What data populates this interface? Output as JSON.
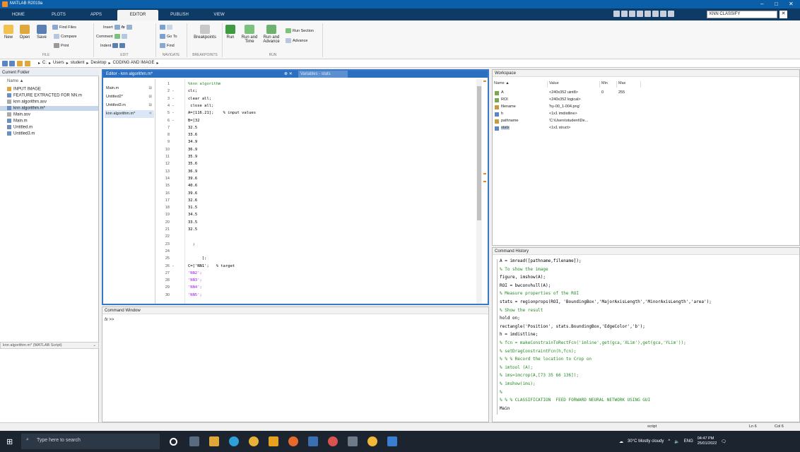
{
  "window": {
    "title": "MATLAB R2019a"
  },
  "tabs": [
    "HOME",
    "PLOTS",
    "APPS",
    "EDITOR",
    "PUBLISH",
    "VIEW"
  ],
  "search": {
    "value": "KNN CLASSIFY"
  },
  "ribbon": {
    "file": {
      "new": "New",
      "open": "Open",
      "save": "Save",
      "find_files": "Find Files",
      "compare": "Compare",
      "print": "Print",
      "group": "FILE"
    },
    "edit": {
      "insert": "Insert",
      "comment": "Comment",
      "indent": "Indent",
      "group": "EDIT"
    },
    "navigate": {
      "goto": "Go To",
      "find": "Find",
      "group": "NAVIGATE"
    },
    "breakpoints": {
      "label": "Breakpoints",
      "group": "BREAKPOINTS"
    },
    "run": {
      "run": "Run",
      "run_and_time": "Run and Time",
      "run_and_advance": "Run and Advance",
      "run_section": "Run Section",
      "advance": "Advance",
      "group": "RUN"
    }
  },
  "address": {
    "crumbs": [
      "C:",
      "Users",
      "student",
      "Desktop",
      "CODING AND IMAGE"
    ]
  },
  "current_folder": {
    "title": "Current Folder",
    "name_col": "Name ▲",
    "items": [
      "INPUT IMAGE",
      "FEATURE EXTRACTED FOR NN.m",
      "knn algorithm.asv",
      "knn algorithm.m*",
      "Main.asv",
      "Main.m",
      "Untitled.m",
      "Untitled3.m"
    ],
    "details": "knn algorithm.m* (MATLAB Script)"
  },
  "editor": {
    "title": "Editor - knn algorithm.m*",
    "variables_tab": "Variables - stats",
    "docs": [
      "Main.m",
      "Untitled2*",
      "Untitled3.m",
      "knn algorithm.m*"
    ],
    "lines": [
      {
        "n": "1",
        "d": "",
        "t": "%knn algorithm"
      },
      {
        "n": "2",
        "d": "-",
        "t": "clc;"
      },
      {
        "n": "3",
        "d": "-",
        "t": "clear all;"
      },
      {
        "n": "4",
        "d": "-",
        "t": " close all;"
      },
      {
        "n": "5",
        "d": "-",
        "t": "A=[116.21];    % input values"
      },
      {
        "n": "6",
        "d": "-",
        "t": "B=[32"
      },
      {
        "n": "7",
        "d": "",
        "t": "32.5"
      },
      {
        "n": "8",
        "d": "",
        "t": "33.6"
      },
      {
        "n": "9",
        "d": "",
        "t": "34.9"
      },
      {
        "n": "10",
        "d": "",
        "t": "36.9"
      },
      {
        "n": "11",
        "d": "",
        "t": "35.9"
      },
      {
        "n": "12",
        "d": "",
        "t": "35.6"
      },
      {
        "n": "13",
        "d": "",
        "t": "36.9"
      },
      {
        "n": "14",
        "d": "",
        "t": "39.6"
      },
      {
        "n": "15",
        "d": "",
        "t": "40.6"
      },
      {
        "n": "16",
        "d": "",
        "t": "39.6"
      },
      {
        "n": "17",
        "d": "",
        "t": "32.6"
      },
      {
        "n": "18",
        "d": "",
        "t": "31.5"
      },
      {
        "n": "19",
        "d": "",
        "t": "34.5"
      },
      {
        "n": "20",
        "d": "",
        "t": "33.5"
      },
      {
        "n": "21",
        "d": "",
        "t": "32.5"
      },
      {
        "n": "22",
        "d": "",
        "t": ""
      },
      {
        "n": "23",
        "d": "",
        "t": "  ;"
      },
      {
        "n": "24",
        "d": "",
        "t": ""
      },
      {
        "n": "25",
        "d": "",
        "t": "      ];"
      },
      {
        "n": "26",
        "d": "-",
        "t": "C=['NN1';   % target"
      },
      {
        "n": "27",
        "d": "",
        "t": "'NN2';"
      },
      {
        "n": "28",
        "d": "",
        "t": "'NN3';"
      },
      {
        "n": "29",
        "d": "",
        "t": "'NN4';"
      },
      {
        "n": "30",
        "d": "",
        "t": "'NN5';"
      }
    ]
  },
  "command_window": {
    "title": "Command Window",
    "prompt": ">>"
  },
  "workspace": {
    "title": "Workspace",
    "cols": [
      "Name ▲",
      "Value",
      "Min",
      "Max"
    ],
    "rows": [
      {
        "name": "A",
        "value": "<240x352 uint8>",
        "min": "0",
        "max": "255"
      },
      {
        "name": "ROI",
        "value": "<240x352 logical>",
        "min": "",
        "max": ""
      },
      {
        "name": "filename",
        "value": "'hy-00_1-004.png'",
        "min": "",
        "max": ""
      },
      {
        "name": "h",
        "value": "<1x1 imdistline>",
        "min": "",
        "max": ""
      },
      {
        "name": "pathname",
        "value": "'C:\\Users\\student\\De...",
        "min": "",
        "max": ""
      },
      {
        "name": "stats",
        "value": "<1x1 struct>",
        "min": "",
        "max": ""
      }
    ]
  },
  "history": {
    "title": "Command History",
    "lines": [
      "A = imread([pathname,filename]);",
      "% To show the image",
      "figure, imshow(A);",
      "ROI = bwconvhull(A);",
      "% Measure properties of the ROI",
      "stats = regionprops(ROI, 'BoundingBox','MajorAxisLength','MinorAxisLength','area');",
      "% Show the result",
      "hold on;",
      "rectangle('Position', stats.BoundingBox,'EdgeColor','b');",
      "h = imdistline;",
      "% fcn = makeConstrainToRectFcn('imline',get(gca,'XLim'),get(gca,'YLim'));",
      "% setDragConstraintFcn(h,fcn);",
      "% % % Record the location to Crop on",
      "% imtool (A);",
      "% ims=imcrop(A,[73 35 66 136]);",
      "% imshow(ims);",
      "%",
      "% % % CLASSIFICATION  FEED FORWARD NEURAL NETWORK USING GUI",
      "Main"
    ]
  },
  "status": {
    "mode": "script",
    "ln": "Ln  6",
    "col": "Col  6"
  },
  "taskbar": {
    "search_placeholder": "Type here to search",
    "weather": "30°C  Mostly cloudy",
    "lang": "ENG",
    "time": "04:47 PM",
    "date": "25/01/2022"
  },
  "colors": {
    "accent": "#0b5ea8",
    "editor_border": "#3b77c7",
    "comment": "#228b22",
    "string": "#a020f0"
  }
}
